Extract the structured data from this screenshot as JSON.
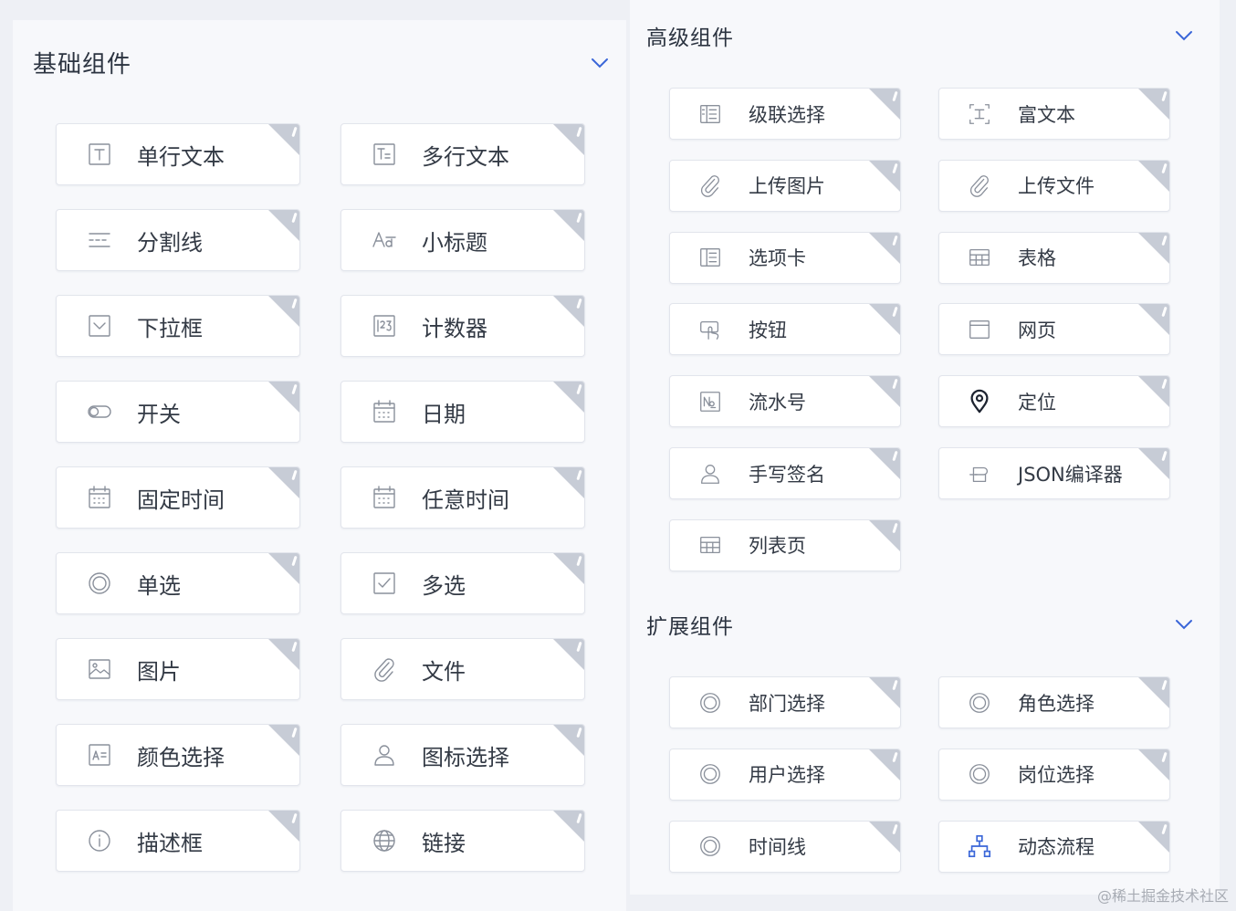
{
  "basic": {
    "title": "基础组件",
    "items": [
      {
        "label": "单行文本",
        "icon": "single-line-text-icon"
      },
      {
        "label": "多行文本",
        "icon": "multi-line-text-icon"
      },
      {
        "label": "分割线",
        "icon": "divider-icon"
      },
      {
        "label": "小标题",
        "icon": "subtitle-icon"
      },
      {
        "label": "下拉框",
        "icon": "dropdown-icon"
      },
      {
        "label": "计数器",
        "icon": "counter-icon"
      },
      {
        "label": "开关",
        "icon": "switch-icon"
      },
      {
        "label": "日期",
        "icon": "calendar-icon"
      },
      {
        "label": "固定时间",
        "icon": "calendar-icon"
      },
      {
        "label": "任意时间",
        "icon": "calendar-icon"
      },
      {
        "label": "单选",
        "icon": "radio-icon"
      },
      {
        "label": "多选",
        "icon": "checkbox-icon"
      },
      {
        "label": "图片",
        "icon": "image-icon"
      },
      {
        "label": "文件",
        "icon": "paperclip-icon"
      },
      {
        "label": "颜色选择",
        "icon": "color-picker-icon"
      },
      {
        "label": "图标选择",
        "icon": "user-icon"
      },
      {
        "label": "描述框",
        "icon": "info-icon"
      },
      {
        "label": "链接",
        "icon": "globe-icon"
      }
    ]
  },
  "advanced": {
    "title": "高级组件",
    "items": [
      {
        "label": "级联选择",
        "icon": "cascader-icon"
      },
      {
        "label": "富文本",
        "icon": "rich-text-icon"
      },
      {
        "label": "上传图片",
        "icon": "paperclip-icon"
      },
      {
        "label": "上传文件",
        "icon": "paperclip-icon"
      },
      {
        "label": "选项卡",
        "icon": "tabs-icon"
      },
      {
        "label": "表格",
        "icon": "table-icon"
      },
      {
        "label": "按钮",
        "icon": "button-hand-icon"
      },
      {
        "label": "网页",
        "icon": "webpage-icon"
      },
      {
        "label": "流水号",
        "icon": "serial-number-icon"
      },
      {
        "label": "定位",
        "icon": "location-pin-icon"
      },
      {
        "label": "手写签名",
        "icon": "user-icon"
      },
      {
        "label": "JSON编译器",
        "icon": "json-editor-icon"
      },
      {
        "label": "列表页",
        "icon": "table-icon"
      }
    ]
  },
  "extended": {
    "title": "扩展组件",
    "items": [
      {
        "label": "部门选择",
        "icon": "radio-icon"
      },
      {
        "label": "角色选择",
        "icon": "radio-icon"
      },
      {
        "label": "用户选择",
        "icon": "radio-icon"
      },
      {
        "label": "岗位选择",
        "icon": "radio-icon"
      },
      {
        "label": "时间线",
        "icon": "radio-icon"
      },
      {
        "label": "动态流程",
        "icon": "flow-chart-icon"
      }
    ]
  },
  "watermark": "@稀土掘金技术社区",
  "colors": {
    "accent": "#3a66d8",
    "icon": "#8a909b",
    "corner": "#c7ccd6"
  }
}
